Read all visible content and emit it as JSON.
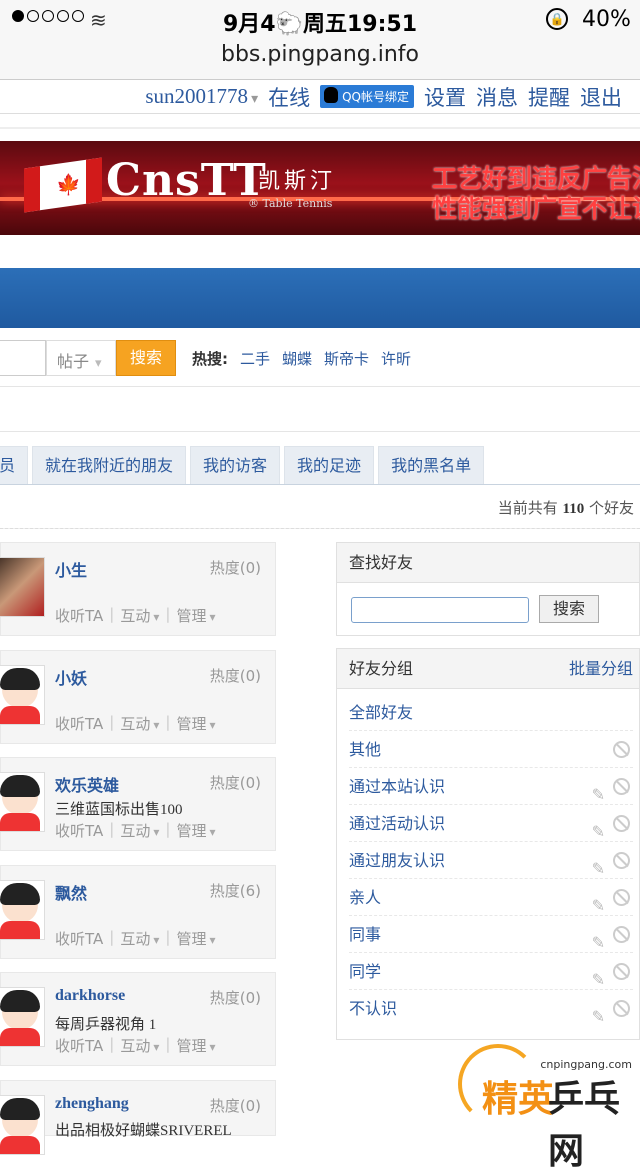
{
  "status": {
    "time": "9月4🐑周五19:51",
    "battery": "40%",
    "signal_dots": 5,
    "signal_filled": 1
  },
  "browser": {
    "url": "bbs.pingpang.info"
  },
  "topnav": {
    "user": "sun2001778",
    "online": "在线",
    "qq": "QQ帐号绑定",
    "settings": "设置",
    "messages": "消息",
    "reminders": "提醒",
    "logout": "退出"
  },
  "banner": {
    "brand": "CnsTT",
    "brand_cn": "凯斯汀",
    "tagline": "® Table Tennis",
    "ad_line1": "工艺好到违反广告法",
    "ad_line2": "性能强到广宣不让说"
  },
  "search": {
    "type": "帖子",
    "button": "搜索",
    "hot_label": "热搜:",
    "hot": [
      "二手",
      "蝴蝶",
      "斯帝卡",
      "许昕"
    ]
  },
  "tabs": [
    "员",
    "就在我附近的朋友",
    "我的访客",
    "我的足迹",
    "我的黑名单"
  ],
  "count": {
    "prefix": "当前共有",
    "number": "110",
    "suffix": "个好友"
  },
  "friends": [
    {
      "name": "小生",
      "heat": "热度(0)",
      "desc": "",
      "photo": true
    },
    {
      "name": "小妖",
      "heat": "热度(0)",
      "desc": ""
    },
    {
      "name": "欢乐英雄",
      "heat": "热度(0)",
      "desc": "三维蓝国标出售100"
    },
    {
      "name": "飘然",
      "heat": "热度(6)",
      "desc": ""
    },
    {
      "name": "darkhorse",
      "heat": "热度(0)",
      "desc": "每周乒器视角 1"
    },
    {
      "name": "zhenghang",
      "heat": "热度(0)",
      "desc": "出品相极好蝴蝶SRIVEREL"
    }
  ],
  "friend_actions": {
    "follow": "收听TA",
    "interact": "互动",
    "manage": "管理"
  },
  "find": {
    "title": "查找好友",
    "button": "搜索",
    "value": ""
  },
  "groups": {
    "title": "好友分组",
    "batch": "批量分组",
    "items": [
      "全部好友",
      "其他",
      "通过本站认识",
      "通过活动认识",
      "通过朋友认识",
      "亲人",
      "同事",
      "同学",
      "不认识"
    ]
  },
  "watermark": {
    "url": "cnpingpang.com",
    "brand1": "精英",
    "brand2": "乒乓网"
  }
}
